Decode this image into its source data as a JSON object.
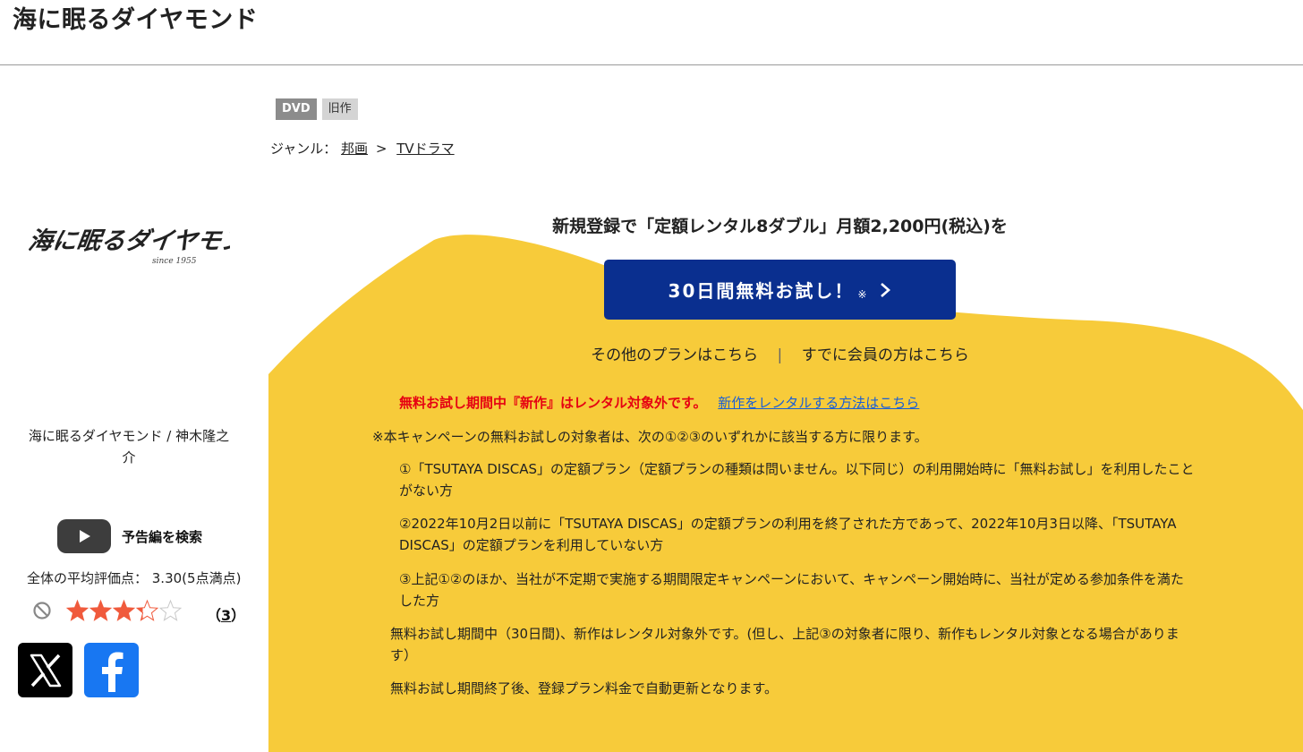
{
  "page": {
    "title": "海に眠るダイヤモンド"
  },
  "badges": {
    "format": "DVD",
    "status": "旧作"
  },
  "genre": {
    "label": "ジャンル：",
    "main": "邦画",
    "separator": ">",
    "sub": "TVドラマ"
  },
  "cover": {
    "logo_text": "海に眠るダイヤモンド",
    "logo_sub": "since 1955"
  },
  "work": {
    "name": "海に眠るダイヤモンド / 神木隆之介"
  },
  "trailer": {
    "label": "予告編を検索",
    "icon": "youtube-play-icon"
  },
  "rating": {
    "average_label": "全体の平均評価点： 3.30(5点満点)",
    "value": 3.3,
    "max": 5,
    "review_count_open": "（",
    "review_count": "3",
    "review_count_close": "）"
  },
  "share": {
    "x": "x-logo-icon",
    "facebook": "facebook-logo-icon"
  },
  "promo": {
    "title": "新規登録で「定額レンタル8ダブル」月額2,200円(税込)を",
    "button_label": "30日間無料お試し！",
    "button_note": "※",
    "other_plans": "その他のプランはこちら",
    "divider": "|",
    "members": "すでに会員の方はこちら"
  },
  "warning": {
    "text": "無料お試し期間中『新作』はレンタル対象外です。",
    "link": "新作をレンタルする方法はこちら"
  },
  "terms": {
    "intro": "※本キャンペーンの無料お試しの対象者は、次の①②③のいずれかに該当する方に限ります。",
    "cond1": "①「TSUTAYA DISCAS」の定額プラン（定額プランの種類は問いません。以下同じ）の利用開始時に「無料お試し」を利用したことがない方",
    "cond2": "②2022年10月2日以前に「TSUTAYA DISCAS」の定額プランの利用を終了された方であって、2022年10月3日以降、「TSUTAYA DISCAS」の定額プランを利用していない方",
    "cond3": "③上記①②のほか、当社が不定期で実施する期間限定キャンペーンにおいて、キャンペーン開始時に、当社が定める参加条件を満たした方",
    "trial_note": "無料お試し期間中（30日間)、新作はレンタル対象外です。(但し、上記③の対象者に限り、新作もレンタル対象となる場合があります）",
    "renew_note": "無料お試し期間終了後、登録プラン料金で自動更新となります。"
  },
  "colors": {
    "yellow": "#f7cb3a",
    "button": "#0a2f8f",
    "warning": "#e60012",
    "link": "#1a5fd6",
    "star": "#f05a3c"
  }
}
